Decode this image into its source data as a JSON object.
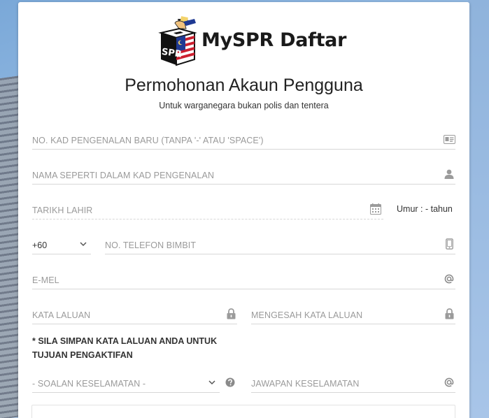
{
  "brand": {
    "name": "MySPR Daftar",
    "logo_text": "SPR"
  },
  "header": {
    "title": "Permohonan Akaun Pengguna",
    "subtitle": "Untuk warganegara bukan polis dan tentera"
  },
  "form": {
    "ic_number": {
      "placeholder": "NO. KAD PENGENALAN BARU (TANPA '-' ATAU 'SPACE')",
      "icon": "id-card-icon"
    },
    "full_name": {
      "placeholder": "NAMA SEPERTI DALAM KAD PENGENALAN",
      "icon": "user-icon"
    },
    "birth_date": {
      "placeholder": "TARIKH LAHIR",
      "icon": "calendar-icon"
    },
    "age_label": "Umur : - tahun",
    "country_code": {
      "value": "+60",
      "icon": "chevron-down-icon"
    },
    "phone": {
      "placeholder": "NO. TELEFON BIMBIT",
      "icon": "mobile-phone-icon"
    },
    "email": {
      "placeholder": "E-MEL",
      "icon": "at-icon"
    },
    "password": {
      "placeholder": "KATA LALUAN",
      "icon": "lock-icon"
    },
    "confirm_password": {
      "placeholder": "MENGESAH KATA LALUAN",
      "icon": "lock-icon"
    },
    "password_note": "* SILA SIMPAN KATA LALUAN ANDA UNTUK TUJUAN PENGAKTIFAN",
    "security_question": {
      "value": "- SOALAN KESELAMATAN -",
      "icon": "question-circle-icon"
    },
    "security_answer": {
      "placeholder": "JAWAPAN KESELAMATAN",
      "icon": "at-icon"
    }
  },
  "colors": {
    "card": "#ffffff",
    "placeholder_text": "#9a9a9a",
    "icon": "#9b9b9b",
    "underline": "#d7d7d7"
  }
}
